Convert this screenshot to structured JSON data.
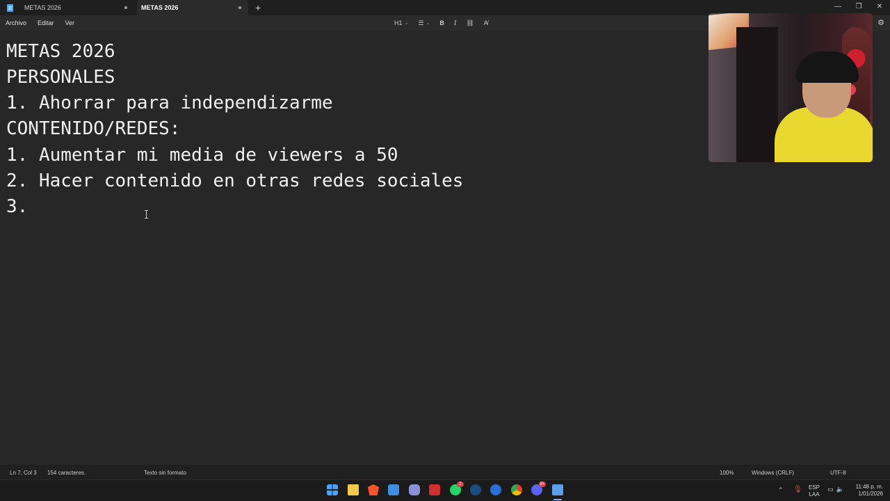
{
  "tabs": [
    {
      "label": "METAS 2026",
      "active": false
    },
    {
      "label": "METAS 2026",
      "active": true
    }
  ],
  "tab_add_symbol": "+",
  "window_controls": {
    "minimize": "—",
    "maximize": "❐",
    "close": "✕"
  },
  "menu": {
    "file": "Archivo",
    "edit": "Editar",
    "view": "Ver"
  },
  "toolbar": {
    "heading": "H1",
    "list_icon": "list-icon",
    "bold": "B",
    "italic": "I",
    "link_icon": "link-icon",
    "format_icon": "clear-format-icon"
  },
  "editor": {
    "lines": [
      "METAS 2026",
      "PERSONALES",
      "1. Ahorrar para independizarme",
      "CONTENIDO/REDES:",
      "1. Aumentar mi media de viewers a 50",
      "2. Hacer contenido en otras redes sociales",
      "3."
    ]
  },
  "status": {
    "position": "Ln 7, Col 3",
    "chars": "154 caracteres.",
    "format": "Texto sin formato",
    "zoom": "100%",
    "line_ending": "Windows (CRLF)",
    "encoding": "UTF-8"
  },
  "taskbar": {
    "badges": {
      "whatsapp": "2",
      "discord": "9+"
    },
    "tray": {
      "lang_1": "ESP",
      "lang_2": "LAA",
      "time": "11:48 p. m.",
      "date": "1/01/2026"
    }
  },
  "colors": {
    "editor_bg": "#272727",
    "toolbar_bg": "#2b2b2b",
    "accent": "#5aa0e6"
  }
}
